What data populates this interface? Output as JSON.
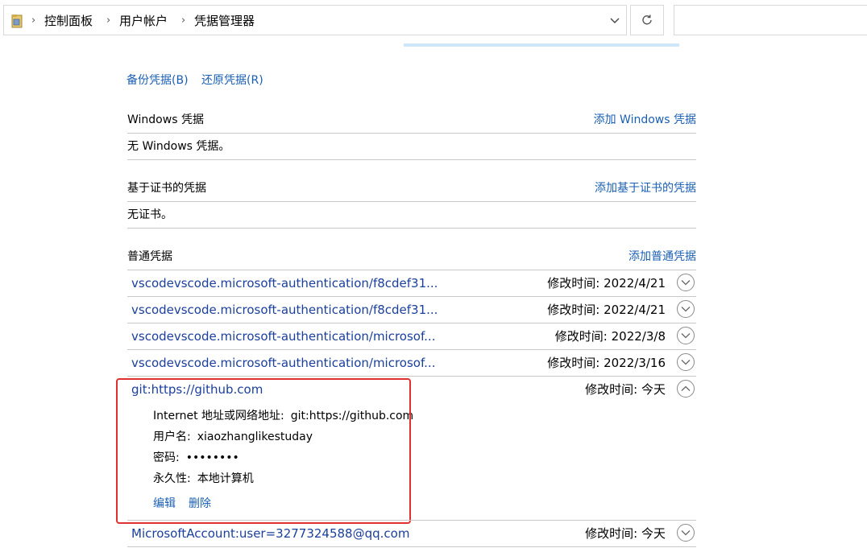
{
  "address_bar": {
    "crumbs": [
      "控制面板",
      "用户帐户",
      "凭据管理器"
    ]
  },
  "top_links": {
    "backup": "备份凭据(B)",
    "restore": "还原凭据(R)"
  },
  "sections": {
    "windows": {
      "title": "Windows 凭据",
      "add": "添加 Windows 凭据",
      "empty": "无 Windows 凭据。"
    },
    "certificate": {
      "title": "基于证书的凭据",
      "add": "添加基于证书的凭据",
      "empty": "无证书。"
    },
    "generic": {
      "title": "普通凭据",
      "add": "添加普通凭据"
    }
  },
  "credentials": [
    {
      "name": "vscodevscode.microsoft-authentication/f8cdef31...",
      "modified": "修改时间:  2022/4/21"
    },
    {
      "name": "vscodevscode.microsoft-authentication/f8cdef31...",
      "modified": "修改时间:  2022/4/21"
    },
    {
      "name": "vscodevscode.microsoft-authentication/microsof...",
      "modified": "修改时间:  2022/3/8"
    },
    {
      "name": "vscodevscode.microsoft-authentication/microsof...",
      "modified": "修改时间:  2022/3/16"
    },
    {
      "name": "git:https://github.com",
      "modified": "修改时间:  今天",
      "expanded": true
    },
    {
      "name": "MicrosoftAccount:user=3277324588@qq.com",
      "modified": "修改时间:  今天"
    }
  ],
  "expanded_detail": {
    "address_label": "Internet 地址或网络地址:",
    "address_value": "git:https://github.com",
    "username_label": "用户名:",
    "username_value": "xiaozhanglikestuday",
    "password_label": "密码:",
    "password_value": "••••••••",
    "persistence_label": "永久性:",
    "persistence_value": "本地计算机",
    "edit": "编辑",
    "delete": "删除"
  },
  "icons": [
    "folder-icon",
    "chevron-right-icon",
    "chevron-down-icon",
    "refresh-icon",
    "expand-icon",
    "collapse-icon"
  ],
  "colors": {
    "link": "#1a5fb4",
    "credential_link": "#1a3f9c",
    "highlight": "#e03030"
  }
}
